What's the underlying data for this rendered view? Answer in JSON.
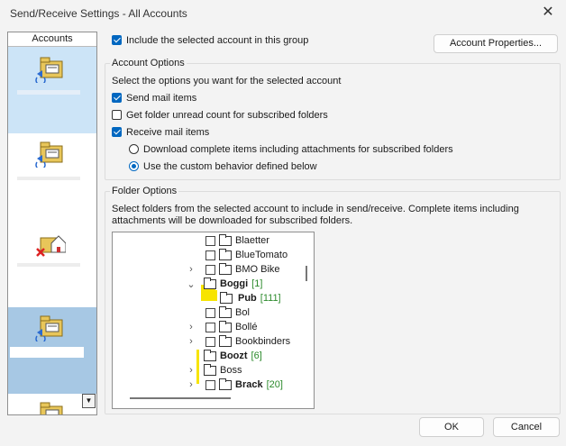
{
  "window": {
    "title": "Send/Receive Settings - All Accounts"
  },
  "accounts_panel": {
    "header": "Accounts"
  },
  "include_group": {
    "label": "Include the selected account in this group",
    "checked": true
  },
  "account_properties_button": "Account Properties...",
  "account_options": {
    "title": "Account Options",
    "description": "Select the options you want for the selected account",
    "send_mail": {
      "label": "Send mail items",
      "checked": true
    },
    "unread_count": {
      "label": "Get folder unread count for subscribed folders",
      "checked": false
    },
    "receive_mail": {
      "label": "Receive mail items",
      "checked": true
    },
    "download_complete": {
      "label": "Download complete items including attachments for subscribed folders",
      "selected": false
    },
    "custom_behavior": {
      "label": "Use the custom behavior defined below",
      "selected": true
    }
  },
  "folder_options": {
    "title": "Folder Options",
    "description": "Select folders from the selected account to include in send/receive. Complete items including attachments will be downloaded for subscribed folders."
  },
  "folders": [
    {
      "name": "Blaetter",
      "count": "",
      "bold": false,
      "expander": "",
      "checkbox": true
    },
    {
      "name": "BlueTomato",
      "count": "",
      "bold": false,
      "expander": "",
      "checkbox": true
    },
    {
      "name": "BMO Bike",
      "count": "",
      "bold": false,
      "expander": ">",
      "checkbox": true
    },
    {
      "name": "Boggi",
      "count": "[1]",
      "bold": true,
      "expander": "v",
      "checkbox": false
    },
    {
      "name": "Pub",
      "count": "[111]",
      "bold": true,
      "expander": "",
      "checkbox": false
    },
    {
      "name": "Bol",
      "count": "",
      "bold": false,
      "expander": "",
      "checkbox": true
    },
    {
      "name": "Bollé",
      "count": "",
      "bold": false,
      "expander": ">",
      "checkbox": true
    },
    {
      "name": "Bookbinders",
      "count": "",
      "bold": false,
      "expander": ">",
      "checkbox": true
    },
    {
      "name": "Boozt",
      "count": "[6]",
      "bold": true,
      "expander": "",
      "checkbox": false
    },
    {
      "name": "Boss",
      "count": "",
      "bold": false,
      "expander": ">",
      "checkbox": false
    },
    {
      "name": "Brack",
      "count": "[20]",
      "bold": true,
      "expander": ">",
      "checkbox": true
    }
  ],
  "buttons": {
    "ok": "OK",
    "cancel": "Cancel"
  },
  "colors": {
    "accent": "#0067c0",
    "count_green": "#2c8a2c",
    "highlight_yellow": "#f7e400",
    "selection_blue": "#cce4f7"
  }
}
